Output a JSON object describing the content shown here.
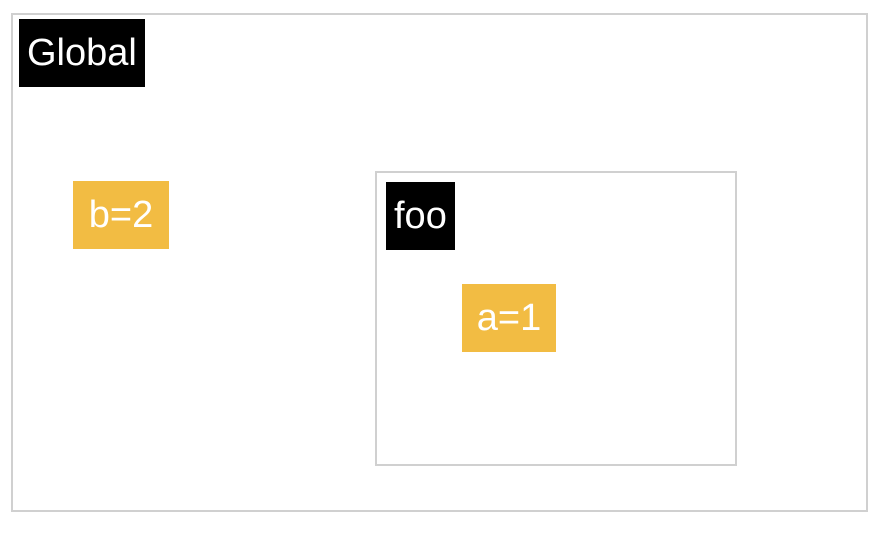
{
  "scopes": {
    "global": {
      "label": "Global",
      "variables": [
        {
          "label": "b=2"
        }
      ]
    },
    "foo": {
      "label": "foo",
      "variables": [
        {
          "label": "a=1"
        }
      ]
    }
  },
  "colors": {
    "label_bg": "#000000",
    "variable_bg": "#f2bc43",
    "border": "#d0d0d0"
  }
}
